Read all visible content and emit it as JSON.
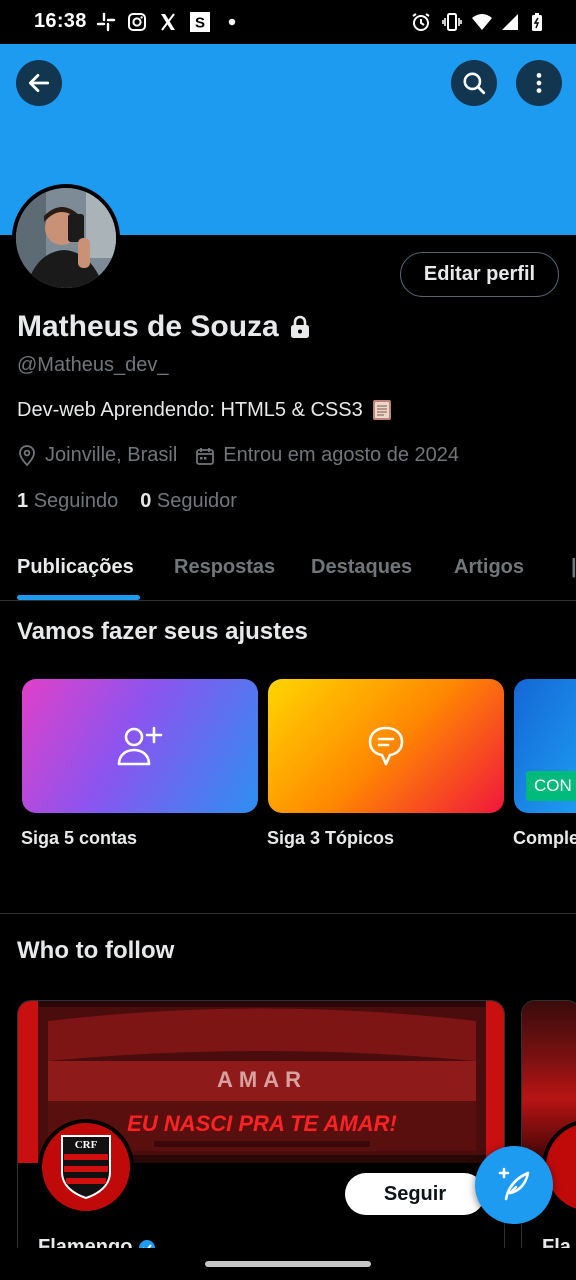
{
  "status_bar": {
    "time": "16:38",
    "left_icons": [
      "slack-icon",
      "instagram-icon",
      "x-icon",
      "s-app-icon",
      "dot-icon"
    ],
    "right_icons": [
      "alarm-icon",
      "vibrate-icon",
      "wifi-icon",
      "signal-icon",
      "battery-icon"
    ]
  },
  "header": {
    "banner_color": "#1d9bf0",
    "back_icon": "back-arrow-icon",
    "search_icon": "search-icon",
    "more_icon": "more-vertical-icon"
  },
  "profile": {
    "name": "Matheus de Souza",
    "handle": "@Matheus_dev_",
    "bio": "Dev-web Aprendendo: HTML5 & CSS3",
    "bio_emoji_icon": "book-icon",
    "location": "Joinville, Brasil",
    "joined": "Entrou em agosto de 2024",
    "following_count": "1",
    "following_label": "Seguindo",
    "followers_count": "0",
    "followers_label": "Seguidor",
    "edit_label": "Editar perfil"
  },
  "tabs": [
    {
      "label": "Publicações",
      "active": true
    },
    {
      "label": "Respostas",
      "active": false
    },
    {
      "label": "Destaques",
      "active": false
    },
    {
      "label": "Artigos",
      "active": false
    }
  ],
  "setup": {
    "title": "Vamos fazer seus ajustes",
    "cards": [
      {
        "label": "Siga 5 contas",
        "icon": "add-user-icon"
      },
      {
        "label": "Siga 3 Tópicos",
        "icon": "topic-bubble-icon"
      },
      {
        "label": "Comple",
        "badge": "CON"
      }
    ]
  },
  "who_to_follow": {
    "title": "Who to follow",
    "account_name": "Flamengo",
    "banner_text": "EU NASCI PRA TE AMAR!",
    "banner_text_small": "AMAR",
    "follow_label": "Seguir",
    "second_card_name": "Fla"
  },
  "colors": {
    "accent": "#1d9bf0",
    "background": "#000000",
    "muted_text": "#71767b",
    "primary_text": "#e7e9ea",
    "flamengo_red": "#c00a0a"
  }
}
